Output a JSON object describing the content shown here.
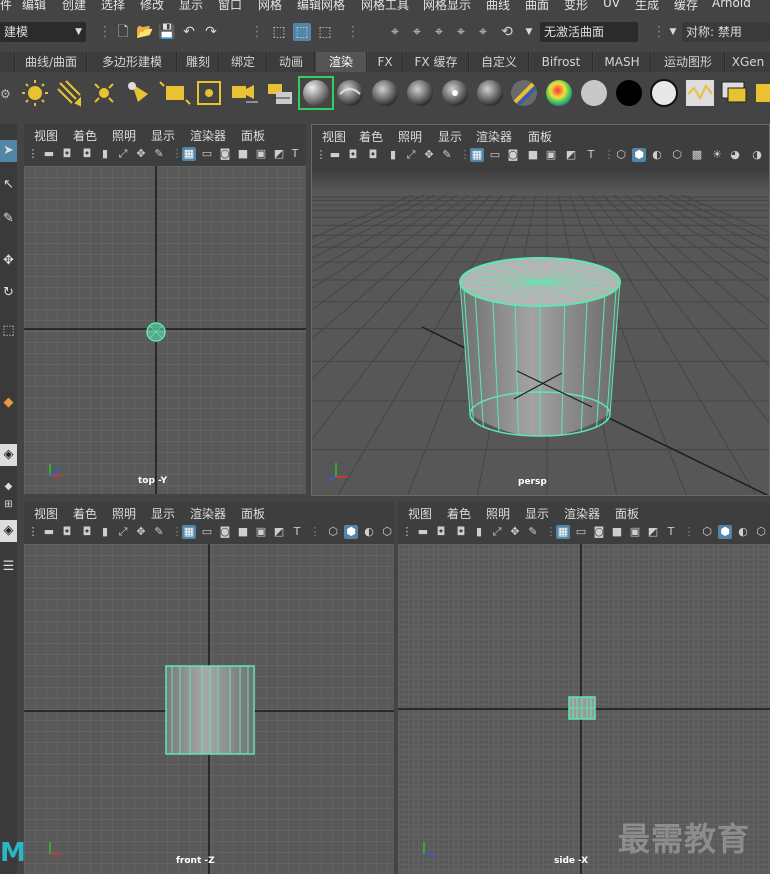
{
  "menubar": {
    "items": [
      "件",
      "编辑",
      "创建",
      "选择",
      "修改",
      "显示",
      "窗口",
      "网格",
      "编辑网格",
      "网格工具",
      "网格显示",
      "曲线",
      "曲面",
      "变形",
      "UV",
      "生成",
      "缓存",
      "Arnold"
    ]
  },
  "status_line": {
    "mode_dropdown": "建模",
    "live_surface": "无激活曲面",
    "symmetry": "对称: 禁用"
  },
  "shelf_tabs": [
    "曲线/曲面",
    "多边形建模",
    "雕刻",
    "绑定",
    "动画",
    "渲染",
    "FX",
    "FX 缓存",
    "自定义",
    "Bifrost",
    "MASH",
    "运动图形",
    "XGen"
  ],
  "active_shelf_tab": "渲染",
  "panel_menus": [
    "视图",
    "着色",
    "照明",
    "显示",
    "渲染器",
    "面板"
  ],
  "viewports": {
    "top": {
      "label": "top -Y"
    },
    "persp": {
      "label": "persp"
    },
    "front": {
      "label": "front -Z"
    },
    "side": {
      "label": "side -X"
    }
  },
  "axis_labels": {
    "x": "x",
    "y": "y",
    "z": "z"
  },
  "colors": {
    "wireframe": "#5ee8b0",
    "selection_highlight": "#5285a6",
    "axis_x": "#e03030",
    "axis_y": "#30c030",
    "axis_z": "#3060e0"
  },
  "watermark": "最需教育",
  "logo_letter": "M"
}
